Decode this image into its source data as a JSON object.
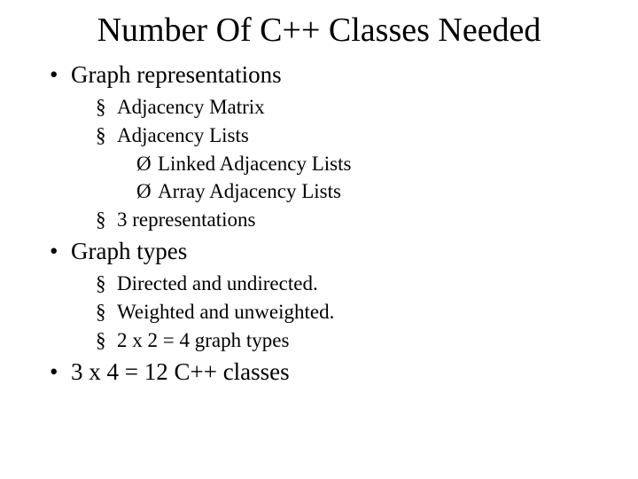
{
  "title": "Number Of C++ Classes Needed",
  "items": {
    "graphRep": "Graph representations",
    "adjMatrix": "Adjacency Matrix",
    "adjLists": "Adjacency Lists",
    "linkedAdj": "Linked Adjacency Lists",
    "arrayAdj": "Array Adjacency Lists",
    "threeRep": "3 representations",
    "graphTypes": "Graph types",
    "dirUndir": "Directed and undirected.",
    "wUnw": "Weighted and unweighted.",
    "twoByTwo": "2 x 2 = 4 graph types",
    "twelve": "3 x 4 = 12 C++ classes"
  }
}
